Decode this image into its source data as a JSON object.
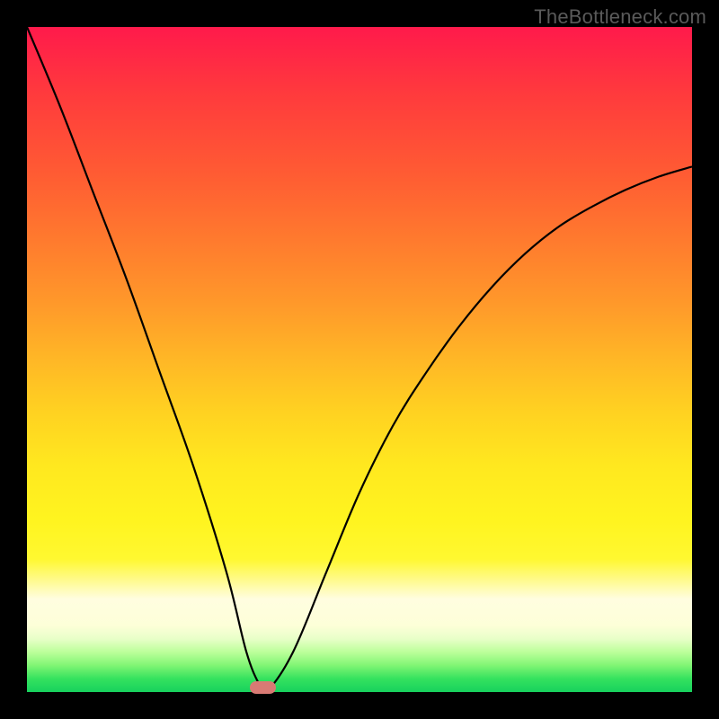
{
  "watermark": "TheBottleneck.com",
  "chart_data": {
    "type": "line",
    "title": "",
    "xlabel": "",
    "ylabel": "",
    "xlim": [
      0,
      100
    ],
    "ylim": [
      0,
      100
    ],
    "grid": false,
    "series": [
      {
        "name": "bottleneck-curve",
        "x": [
          0,
          5,
          10,
          15,
          20,
          25,
          30,
          33,
          35,
          36,
          40,
          45,
          50,
          55,
          60,
          65,
          70,
          75,
          80,
          85,
          90,
          95,
          100
        ],
        "y": [
          100,
          88,
          75,
          62,
          48,
          34,
          18,
          6,
          1,
          0,
          6,
          18,
          30,
          40,
          48,
          55,
          61,
          66,
          70,
          73,
          75.5,
          77.5,
          79
        ]
      }
    ],
    "marker": {
      "x": 35.5,
      "width": 4,
      "color": "#d97a74"
    },
    "gradient_stops": [
      {
        "pos": 0,
        "color": "#ff1a4b"
      },
      {
        "pos": 50,
        "color": "#ffb726"
      },
      {
        "pos": 80,
        "color": "#fff830"
      },
      {
        "pos": 98,
        "color": "#35e25e"
      },
      {
        "pos": 100,
        "color": "#17d15d"
      }
    ]
  }
}
